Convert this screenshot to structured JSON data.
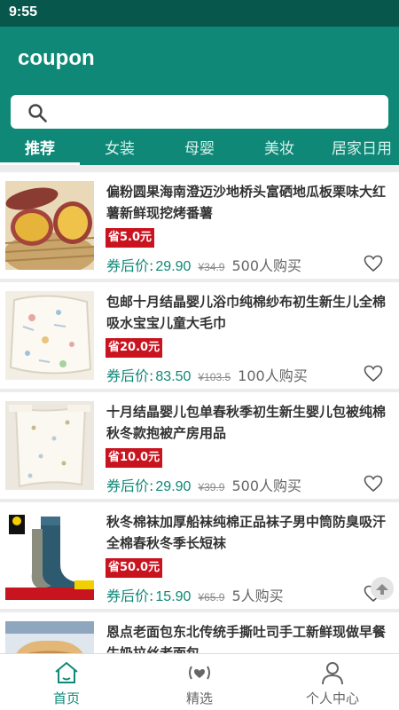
{
  "status_bar": {
    "time": "9:55"
  },
  "app_bar": {
    "title": "coupon"
  },
  "search": {
    "placeholder": ""
  },
  "tabs": [
    {
      "label": "推荐",
      "active": true
    },
    {
      "label": "女装",
      "active": false
    },
    {
      "label": "母婴",
      "active": false
    },
    {
      "label": "美妆",
      "active": false
    },
    {
      "label": "居家日用",
      "active": false
    }
  ],
  "products": [
    {
      "name": "偏粉圆果海南澄迈沙地桥头富硒地瓜板栗味大红薯新鲜现挖烤番薯",
      "save": "省5.0元",
      "price_label": "券后价:",
      "price": "29.90",
      "original_price": "¥34.9",
      "sold": "500人购买",
      "image": "sweet-potato"
    },
    {
      "name": "包邮十月结晶婴儿浴巾纯棉纱布初生新生儿全棉吸水宝宝儿童大毛巾",
      "save": "省20.0元",
      "price_label": "券后价:",
      "price": "83.50",
      "original_price": "¥103.5",
      "sold": "100人购买",
      "image": "baby-towel"
    },
    {
      "name": "十月结晶婴儿包单春秋季初生新生婴儿包被纯棉秋冬款抱被产房用品",
      "save": "省10.0元",
      "price_label": "券后价:",
      "price": "29.90",
      "original_price": "¥39.9",
      "sold": "500人购买",
      "image": "baby-blanket"
    },
    {
      "name": "秋冬棉袜加厚船袜纯棉正品袜子男中筒防臭吸汗全棉春秋冬季长短袜",
      "save": "省50.0元",
      "price_label": "券后价:",
      "price": "15.90",
      "original_price": "¥65.9",
      "sold": "5人购买",
      "image": "socks"
    },
    {
      "name": "恩点老面包东北传统手撕吐司手工新鲜现做早餐牛奶拉丝老面包",
      "save": "",
      "price_label": "",
      "price": "",
      "original_price": "",
      "sold": "",
      "image": "bread"
    }
  ],
  "bottom_nav": [
    {
      "label": "首页",
      "icon": "home-icon",
      "active": true
    },
    {
      "label": "精选",
      "icon": "broadcast-heart-icon",
      "active": false
    },
    {
      "label": "个人中心",
      "icon": "person-icon",
      "active": false
    }
  ],
  "colors": {
    "primary": "#0f8877",
    "status_bar": "#08574d",
    "save_badge": "#c9131f"
  }
}
